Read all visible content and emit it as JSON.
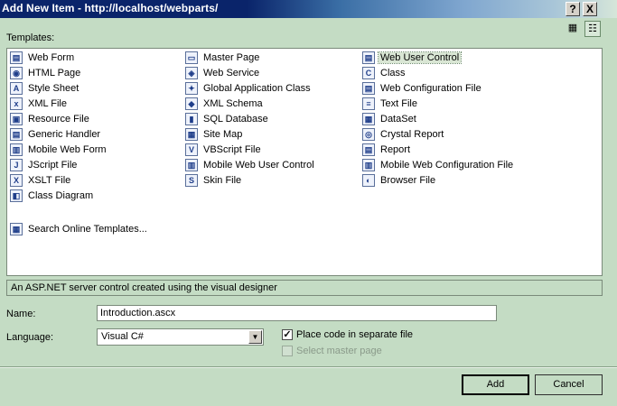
{
  "window": {
    "title": "Add New Item - http://localhost/webparts/"
  },
  "titlebar_buttons": {
    "help": "?",
    "close": "X"
  },
  "templates_label": "Templates:",
  "view_buttons": {
    "large_icons": "▦",
    "small_icons": "☷"
  },
  "templates": [
    [
      {
        "label": "Web Form",
        "icon": "web-form-icon",
        "glyph": "▤"
      },
      {
        "label": "HTML Page",
        "icon": "html-page-icon",
        "glyph": "◉"
      },
      {
        "label": "Style Sheet",
        "icon": "style-sheet-icon",
        "glyph": "A"
      },
      {
        "label": "XML File",
        "icon": "xml-file-icon",
        "glyph": "x"
      },
      {
        "label": "Resource File",
        "icon": "resource-file-icon",
        "glyph": "▣"
      },
      {
        "label": "Generic Handler",
        "icon": "generic-handler-icon",
        "glyph": "▤"
      },
      {
        "label": "Mobile Web Form",
        "icon": "mobile-web-form-icon",
        "glyph": "▥"
      },
      {
        "label": "JScript File",
        "icon": "jscript-file-icon",
        "glyph": "J"
      },
      {
        "label": "XSLT File",
        "icon": "xslt-file-icon",
        "glyph": "X"
      },
      {
        "label": "Class Diagram",
        "icon": "class-diagram-icon",
        "glyph": "◧"
      }
    ],
    [
      {
        "label": "Master Page",
        "icon": "master-page-icon",
        "glyph": "▭"
      },
      {
        "label": "Web Service",
        "icon": "web-service-icon",
        "glyph": "◈"
      },
      {
        "label": "Global Application Class",
        "icon": "global-application-class-icon",
        "glyph": "✦"
      },
      {
        "label": "XML Schema",
        "icon": "xml-schema-icon",
        "glyph": "◆"
      },
      {
        "label": "SQL Database",
        "icon": "sql-database-icon",
        "glyph": "▮"
      },
      {
        "label": "Site Map",
        "icon": "site-map-icon",
        "glyph": "▦"
      },
      {
        "label": "VBScript File",
        "icon": "vbscript-file-icon",
        "glyph": "V"
      },
      {
        "label": "Mobile Web User Control",
        "icon": "mobile-web-user-control-icon",
        "glyph": "▥"
      },
      {
        "label": "Skin File",
        "icon": "skin-file-icon",
        "glyph": "S"
      }
    ],
    [
      {
        "label": "Web User Control",
        "icon": "web-user-control-icon",
        "glyph": "▤",
        "selected": true
      },
      {
        "label": "Class",
        "icon": "class-icon",
        "glyph": "C"
      },
      {
        "label": "Web Configuration File",
        "icon": "web-configuration-file-icon",
        "glyph": "▤"
      },
      {
        "label": "Text File",
        "icon": "text-file-icon",
        "glyph": "≡"
      },
      {
        "label": "DataSet",
        "icon": "dataset-icon",
        "glyph": "▦"
      },
      {
        "label": "Crystal Report",
        "icon": "crystal-report-icon",
        "glyph": "◎"
      },
      {
        "label": "Report",
        "icon": "report-icon",
        "glyph": "▤"
      },
      {
        "label": "Mobile Web Configuration File",
        "icon": "mobile-web-configuration-file-icon",
        "glyph": "▥"
      },
      {
        "label": "Browser File",
        "icon": "browser-file-icon",
        "glyph": "◐"
      }
    ]
  ],
  "search_online": {
    "label": "Search Online Templates...",
    "icon": "search-online-templates-icon",
    "glyph": "▦"
  },
  "description": "An ASP.NET server control created using the visual designer",
  "form": {
    "name_label": "Name:",
    "name_value": "Introduction.ascx",
    "language_label": "Language:",
    "language_value": "Visual C#",
    "place_code_label": "Place code in separate file",
    "place_code_checked": true,
    "select_master_label": "Select master page",
    "select_master_checked": false,
    "select_master_enabled": false
  },
  "buttons": {
    "add": "Add",
    "cancel": "Cancel"
  },
  "colors": {
    "dialog_bg": "#c4dcc4",
    "title_bar": "#0a246a",
    "selection": "#d9e6d4"
  }
}
